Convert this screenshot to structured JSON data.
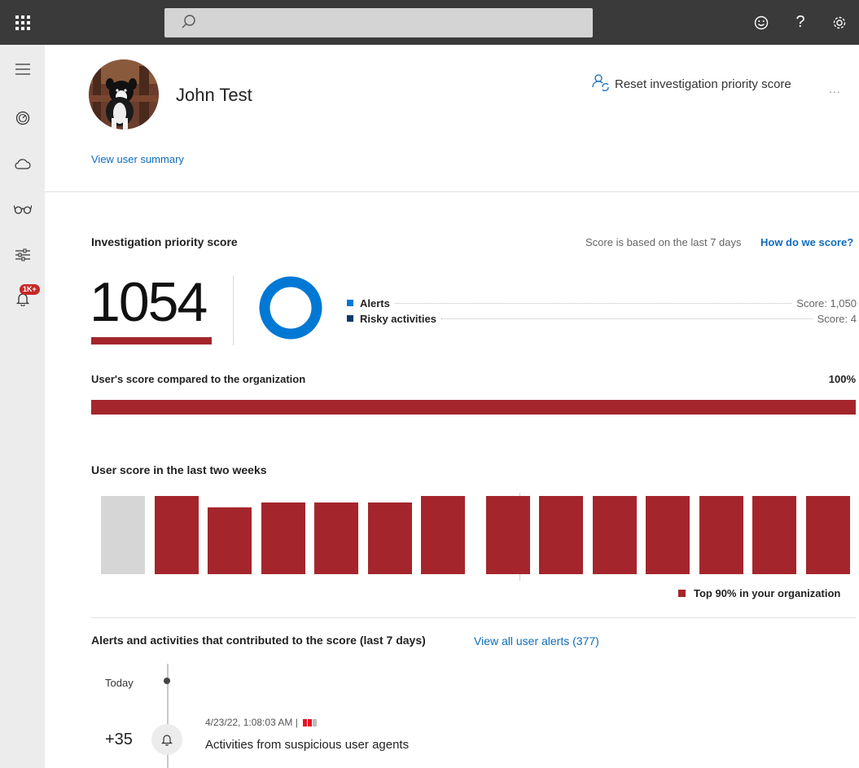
{
  "topbar": {
    "search_placeholder": "",
    "icons": [
      "app-launcher-icon",
      "search-icon",
      "smiley-icon",
      "help-icon",
      "gear-icon"
    ],
    "help_glyph": "?"
  },
  "rail": {
    "items": [
      "menu-icon",
      "dashboard-icon",
      "cloud-icon",
      "glasses-icon",
      "settings-sliders-icon",
      "alerts-bell-icon"
    ],
    "alerts_badge": "1K+"
  },
  "user": {
    "name": "John Test",
    "summary_link": "View user summary",
    "reset_label": "Reset investigation priority score",
    "more_label": "..."
  },
  "priority": {
    "title": "Investigation priority score",
    "score_note": "Score is based on the last 7 days",
    "how_link": "How do we score?",
    "score": "1054",
    "legend": [
      {
        "label": "Alerts",
        "score": "Score: 1,050",
        "color": "#0078d4"
      },
      {
        "label": "Risky activities",
        "score": "Score: 4",
        "color": "#0b3a6b"
      }
    ]
  },
  "compare": {
    "label": "User's score compared to the organization",
    "percent": "100%",
    "fill_fraction": 1.0
  },
  "history": {
    "title": "User score in the last two weeks",
    "legend_label": "Top 90% in your organization"
  },
  "chart_data": {
    "type": "bar",
    "title": "User score in the last two weeks",
    "values": [
      0.66,
      0.66,
      0.56,
      0.6,
      0.6,
      0.6,
      0.7,
      0.7,
      0.7,
      0.7,
      0.68,
      0.68,
      0.68,
      0.68
    ],
    "colors": [
      "#d6d6d6",
      "#a4262c",
      "#a4262c",
      "#a4262c",
      "#a4262c",
      "#a4262c",
      "#a4262c",
      "#a4262c",
      "#a4262c",
      "#a4262c",
      "#a4262c",
      "#a4262c",
      "#a4262c",
      "#a4262c"
    ],
    "ylim": [
      0,
      1
    ],
    "legend": [
      "Top 90% in your organization"
    ],
    "grid": false
  },
  "alerts": {
    "title": "Alerts and activities that contributed to the score (last 7 days)",
    "view_all_link": "View all user alerts (377)",
    "today_label": "Today",
    "items": [
      {
        "delta": "+35",
        "time": "4/23/22, 1:08:03 AM |",
        "name": "Activities from suspicious user agents",
        "severity": [
          "#e81123",
          "#e81123",
          "#bdbdbd"
        ]
      }
    ]
  },
  "colors": {
    "accent": "#0f6cbd",
    "score_red": "#a4262c",
    "donut_blue": "#0078d4"
  }
}
